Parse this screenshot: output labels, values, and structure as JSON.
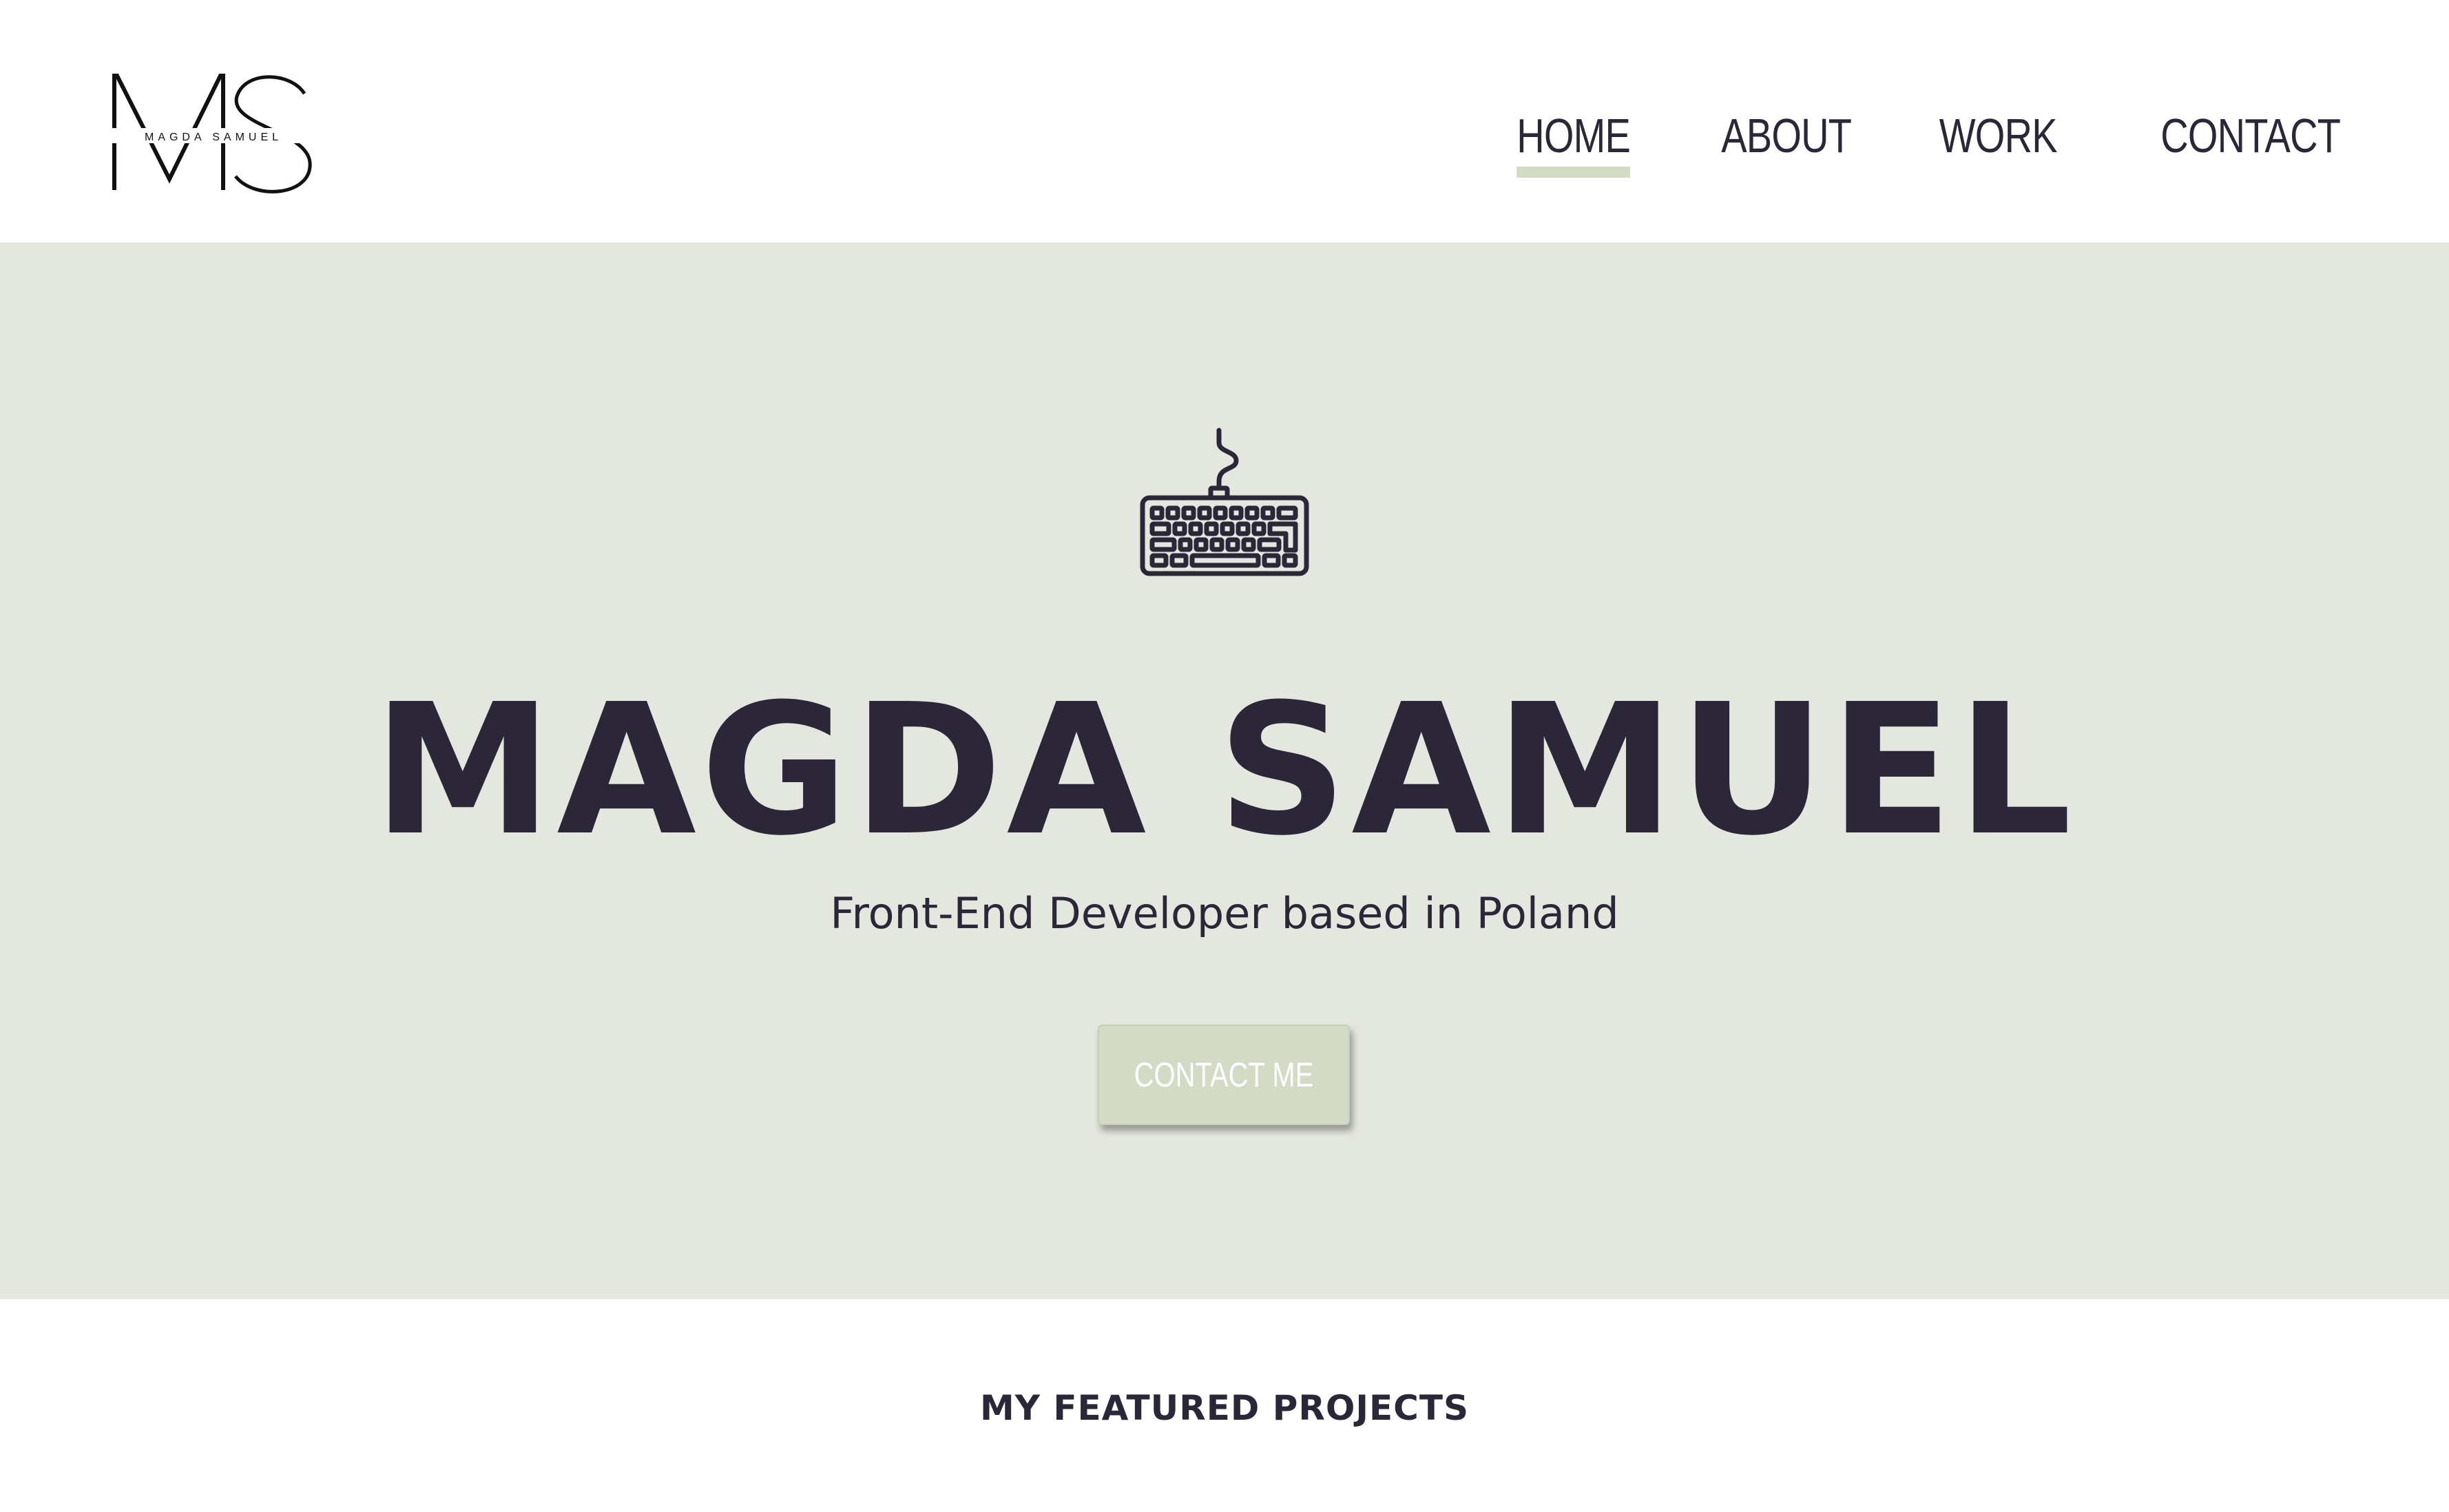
{
  "logo": {
    "monogram": "MS",
    "name": "MAGDA SAMUEL",
    "icon": "ms-monogram-logo"
  },
  "nav": {
    "items": [
      {
        "label": "HOME",
        "active": true
      },
      {
        "label": "ABOUT",
        "active": false
      },
      {
        "label": "WORK",
        "active": false
      },
      {
        "label": "CONTACT",
        "active": false
      }
    ]
  },
  "hero": {
    "icon": "keyboard-icon",
    "title": "MAGDA SAMUEL",
    "subtitle": "Front-End Developer based in Poland",
    "cta_label": "CONTACT ME"
  },
  "projects": {
    "heading": "MY FEATURED PROJECTS"
  },
  "colors": {
    "text": "#2c2738",
    "hero_background": "#e4e7dd",
    "accent": "#d3dbc5",
    "page_background": "#ffffff"
  }
}
